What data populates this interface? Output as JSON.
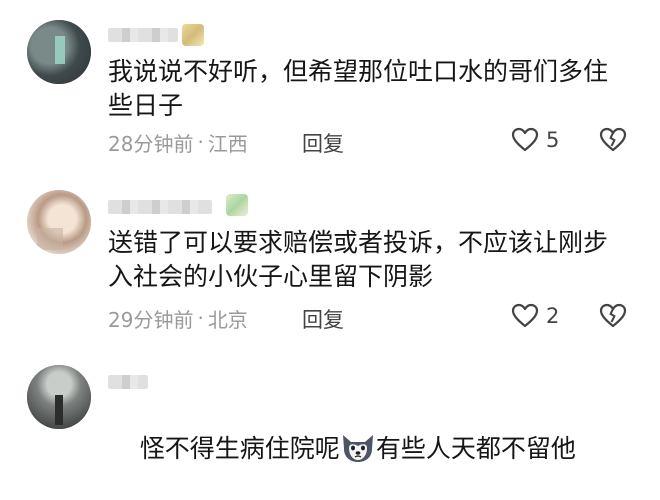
{
  "comments": [
    {
      "text": "我说说不好听，但希望那位吐口水的哥们多住些日子",
      "time": "28分钟前",
      "location": "江西",
      "reply_label": "回复",
      "like_count": "5"
    },
    {
      "text": "送错了可以要求赔偿或者投诉，不应该让刚步入社会的小伙子心里留下阴影",
      "time": "29分钟前",
      "location": "北京",
      "reply_label": "回复",
      "like_count": "2"
    },
    {
      "text_before_emoji": "怪不得生病住院呢",
      "text_after_emoji": "有些人天都不留他"
    }
  ],
  "separator": "·",
  "icons": {
    "like": "heart-outline-icon",
    "dislike": "broken-heart-icon",
    "emoji": "husky-dog-emoji"
  },
  "colors": {
    "text": "#161616",
    "meta": "#9a9a9a",
    "icon": "#444444"
  }
}
